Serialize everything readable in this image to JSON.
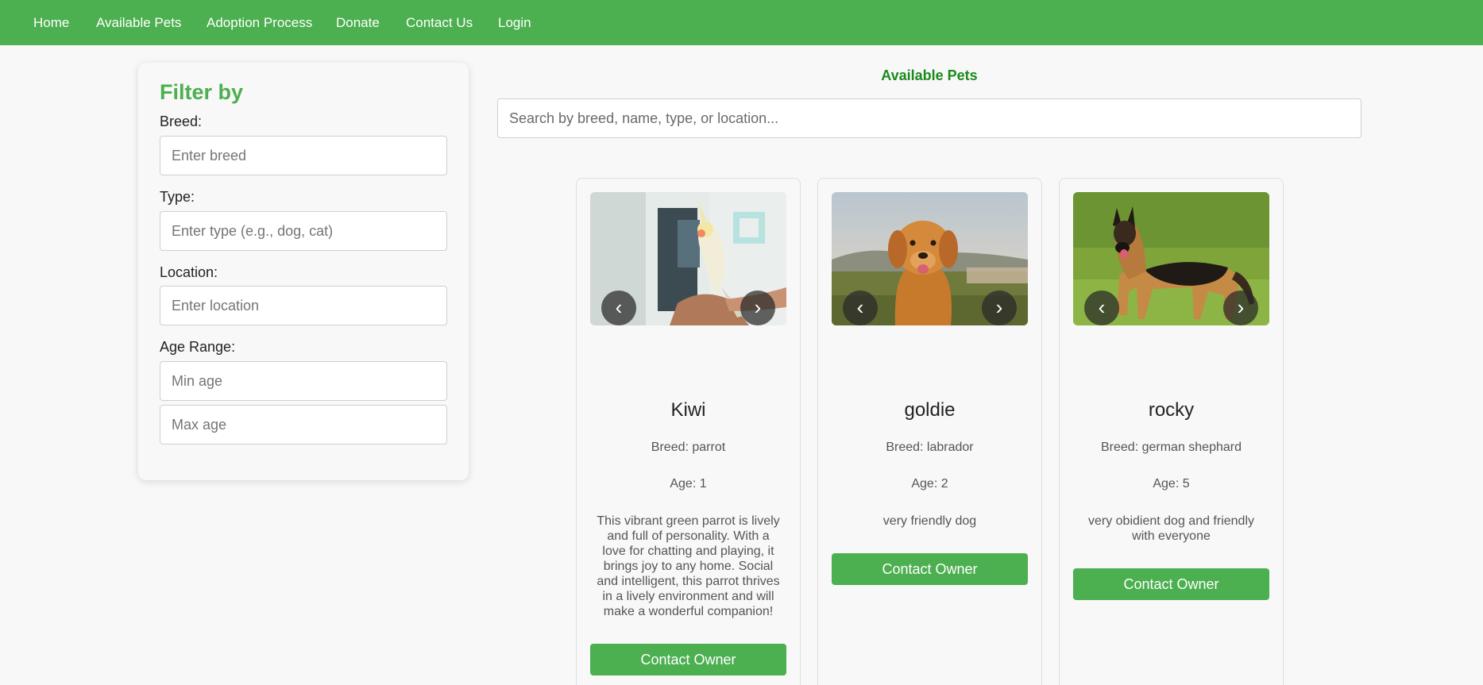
{
  "nav": {
    "items": [
      "Home",
      "Available Pets",
      "Adoption Process",
      "Donate",
      "Contact Us",
      "Login"
    ]
  },
  "filter": {
    "title": "Filter by",
    "breed_label": "Breed:",
    "breed_placeholder": "Enter breed",
    "type_label": "Type:",
    "type_placeholder": "Enter type (e.g., dog, cat)",
    "location_label": "Location:",
    "location_placeholder": "Enter location",
    "age_label": "Age Range:",
    "min_age_placeholder": "Min age",
    "max_age_placeholder": "Max age"
  },
  "main": {
    "title": "Available Pets",
    "search_placeholder": "Search by breed, name, type, or location..."
  },
  "carousel": {
    "prev": "‹",
    "next": "›"
  },
  "pets": [
    {
      "name": "Kiwi",
      "breed": "Breed: parrot",
      "age": "Age: 1",
      "description": "This vibrant green parrot is lively and full of personality. With a love for chatting and playing, it brings joy to any home. Social and intelligent, this parrot thrives in a lively environment and will make a wonderful companion!",
      "button": "Contact Owner",
      "image": "parrot-photo"
    },
    {
      "name": "goldie",
      "breed": "Breed: labrador",
      "age": "Age: 2",
      "description": "very friendly dog",
      "button": "Contact Owner",
      "image": "golden-dog-photo"
    },
    {
      "name": "rocky",
      "breed": "Breed: german shephard",
      "age": "Age: 5",
      "description": "very obidient dog and friendly with everyone",
      "button": "Contact Owner",
      "image": "german-shepherd-photo"
    }
  ],
  "colors": {
    "brand": "#4caf50",
    "title_green": "#1a8a1a",
    "background": "#f8f8f8"
  }
}
